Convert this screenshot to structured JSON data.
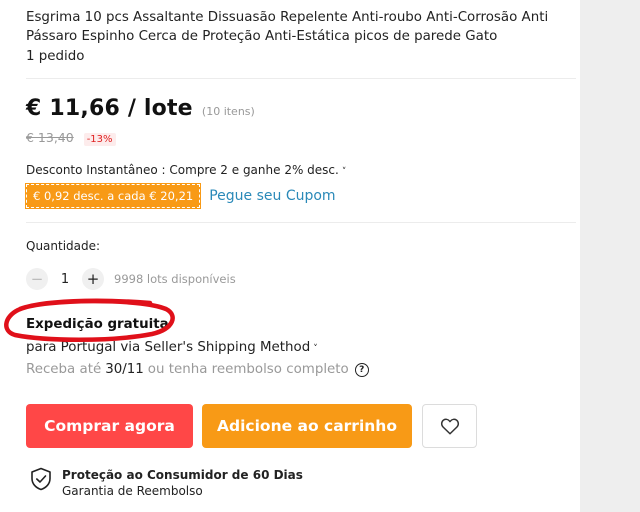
{
  "product": {
    "title": "Esgrima 10 pcs Assaltante Dissuasão Repelente Anti-roubo Anti-Corrosão Anti Pássaro Espinho Cerca de Proteção Anti-Estática picos de parede Gato",
    "orders": "1 pedido"
  },
  "price": {
    "current": "€ 11,66 / lote",
    "lot_note": "(10 itens)",
    "original": "€ 13,40",
    "discount": "-13%"
  },
  "promo": {
    "instant_discount": "Desconto Instantâneo : Compre 2 e ganhe 2% desc.",
    "coupon_badge": "€ 0,92 desc. a cada € 20,21",
    "coupon_link": "Pegue seu Cupom"
  },
  "quantity": {
    "label": "Quantidade:",
    "minus": "−",
    "value": "1",
    "plus": "+",
    "available": "9998 lots disponíveis"
  },
  "shipping": {
    "title": "Expedição gratuita",
    "method": "para Portugal via Seller's Shipping Method",
    "eta_prefix": "Receba até",
    "eta_date": "30/11",
    "eta_suffix": "ou tenha reembolso completo"
  },
  "actions": {
    "buy_now": "Comprar agora",
    "add_to_cart": "Adicione ao carrinho"
  },
  "protection": {
    "title": "Proteção ao Consumidor de 60 Dias",
    "subtitle": "Garantia de Reembolso"
  },
  "colors": {
    "accent_red": "#ff4747",
    "accent_orange": "#f89a16",
    "link_blue": "#2a89b8",
    "annotation_red": "#e0101a"
  },
  "icons": {
    "chevron": "chevron-down-icon",
    "help": "question-circle-icon",
    "wishlist": "heart-icon",
    "protection": "shield-check-icon"
  }
}
